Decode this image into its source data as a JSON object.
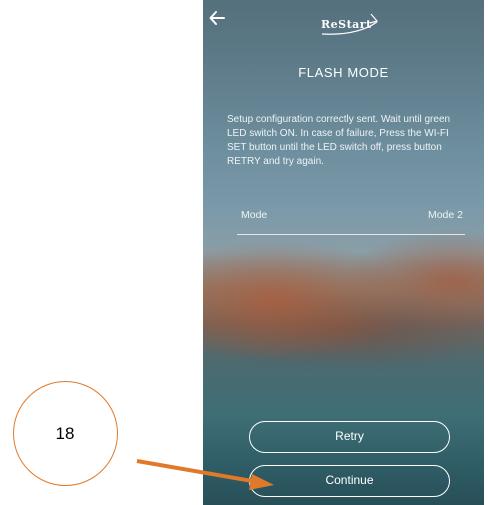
{
  "header": {
    "back_icon": "arrow-left-icon",
    "logo_text": "ReStart"
  },
  "page_title": "FLASH MODE",
  "message": "Setup configuration correctly sent. Wait until green LED switch ON. In case of failure, Press the WI-FI SET button until the LED switch off, press button RETRY and try again.",
  "mode_row": {
    "label": "Mode",
    "value": "Mode 2"
  },
  "buttons": {
    "retry": "Retry",
    "continue": "Continue"
  },
  "annotation": {
    "step_number": "18",
    "color": "#e07a2a"
  }
}
